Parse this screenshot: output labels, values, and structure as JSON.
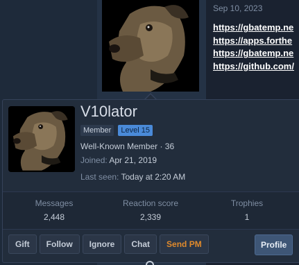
{
  "post": {
    "date": "Sep 10, 2023",
    "links": [
      "https://gbatemp.ne",
      "https://apps.forthe",
      "https://gbatemp.ne",
      "https://github.com/"
    ]
  },
  "card": {
    "username": "V10lator",
    "badge_member": "Member",
    "badge_level": "Level 15",
    "user_title": "Well-Known Member · 36",
    "joined_label": "Joined:",
    "joined_value": "Apr 21, 2019",
    "lastseen_label": "Last seen:",
    "lastseen_value": "Today at 2:20 AM",
    "stats": [
      {
        "label": "Messages",
        "value": "2,448"
      },
      {
        "label": "Reaction score",
        "value": "2,339"
      },
      {
        "label": "Trophies",
        "value": "1"
      }
    ],
    "actions": {
      "gift": "Gift",
      "follow": "Follow",
      "ignore": "Ignore",
      "chat": "Chat",
      "send_pm": "Send PM",
      "profile": "Profile"
    }
  },
  "colors": {
    "background": "#1d2634",
    "card": "#222d3c",
    "level_badge": "#4a8ad8",
    "send_pm": "#e08a2c",
    "profile_button": "#3e5676"
  }
}
